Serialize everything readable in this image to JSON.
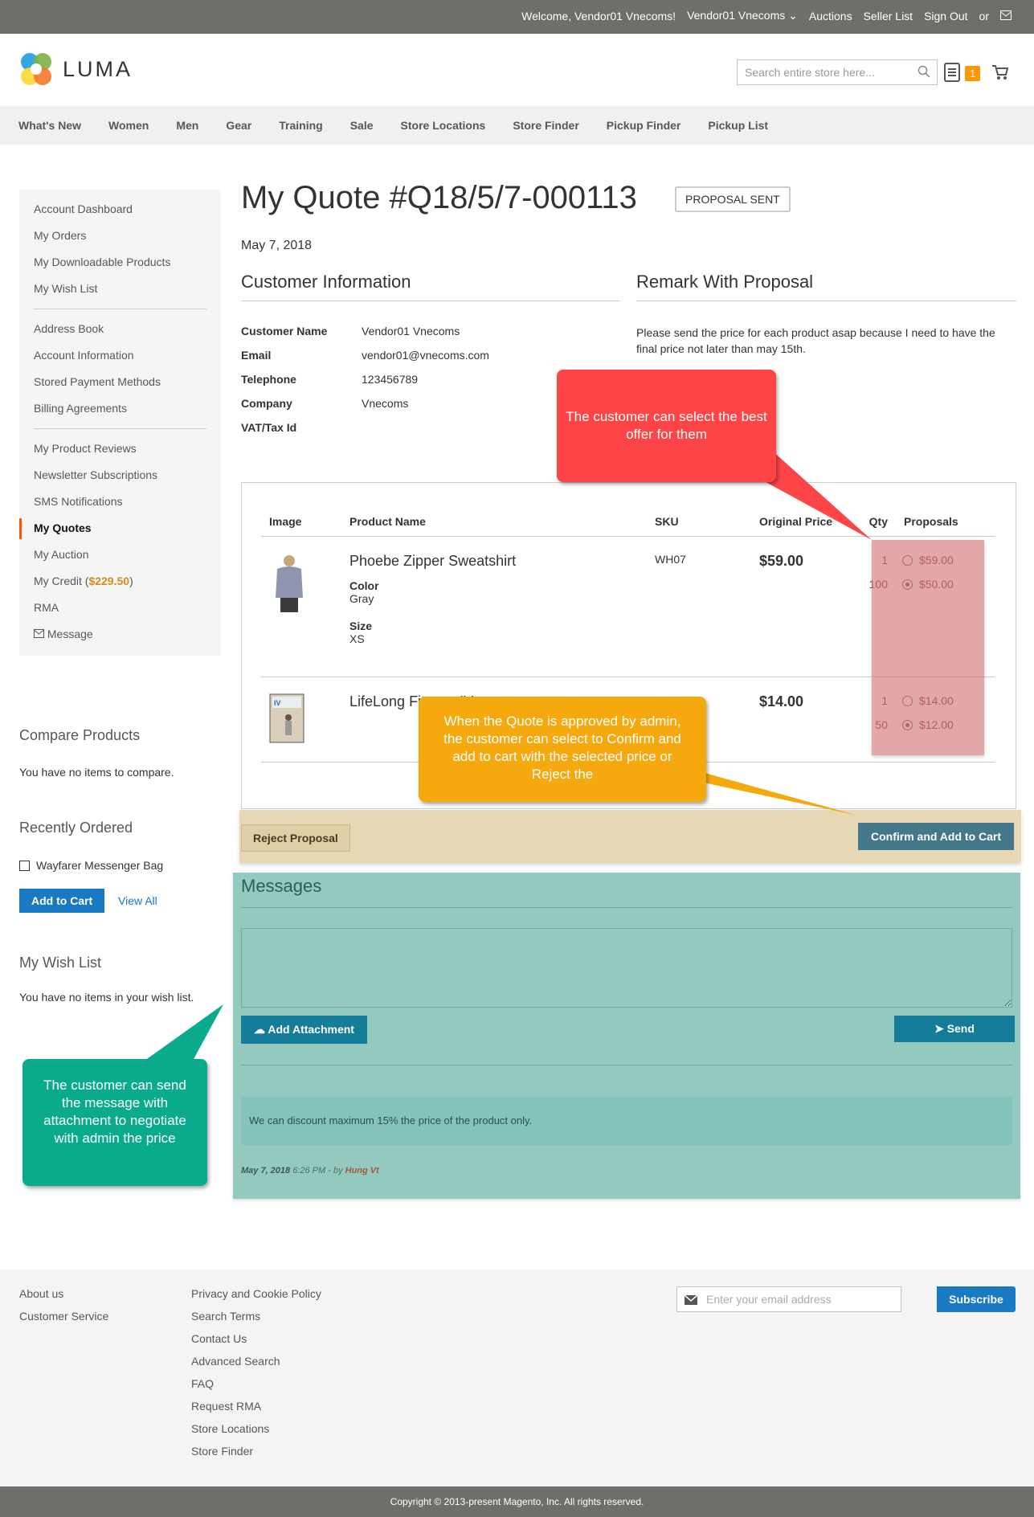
{
  "topbar": {
    "welcome": "Welcome, Vendor01 Vnecoms!",
    "account": "Vendor01 Vnecoms",
    "links": [
      "Auctions",
      "Seller List",
      "Sign Out"
    ],
    "or": "or"
  },
  "header": {
    "logo": "LUMA",
    "search_placeholder": "Search entire store here...",
    "cart_count": "1"
  },
  "nav": [
    "What's New",
    "Women",
    "Men",
    "Gear",
    "Training",
    "Sale",
    "Store Locations",
    "Store Finder",
    "Pickup Finder",
    "Pickup List"
  ],
  "sidebar": {
    "group1": [
      "Account Dashboard",
      "My Orders",
      "My Downloadable Products",
      "My Wish List"
    ],
    "group2": [
      "Address Book",
      "Account Information",
      "Stored Payment Methods",
      "Billing Agreements"
    ],
    "group3": [
      "My Product Reviews",
      "Newsletter Subscriptions",
      "SMS Notifications",
      "My Quotes",
      "My Auction"
    ],
    "credit_label": "My Credit (",
    "credit_value": "$229.50",
    "credit_close": ")",
    "rma": "RMA",
    "message": "Message",
    "active": "My Quotes"
  },
  "compare": {
    "title": "Compare Products",
    "text": "You have no items to compare."
  },
  "recent": {
    "title": "Recently Ordered",
    "item": "Wayfarer Messenger Bag",
    "add_to_cart": "Add to Cart",
    "view_all": "View All"
  },
  "wishlist": {
    "title": "My Wish List",
    "text": "You have no items in your wish list."
  },
  "quote": {
    "title": "My Quote #Q18/5/7-000113",
    "status": "PROPOSAL SENT",
    "date": "May 7, 2018",
    "customer_title": "Customer Information",
    "remark_title": "Remark With Proposal",
    "fields": [
      {
        "label": "Customer Name",
        "value": "Vendor01 Vnecoms"
      },
      {
        "label": "Email",
        "value": "vendor01@vnecoms.com"
      },
      {
        "label": "Telephone",
        "value": "123456789"
      },
      {
        "label": "Company",
        "value": "Vnecoms"
      },
      {
        "label": "VAT/Tax Id",
        "value": ""
      }
    ],
    "remark": "Please send the price for each product asap because I need to have the final price not later than may 15th."
  },
  "table": {
    "headers": [
      "Image",
      "Product Name",
      "SKU",
      "Original Price",
      "Qty",
      "Proposals"
    ],
    "rows": [
      {
        "name": "Phoebe Zipper Sweatshirt",
        "options": [
          {
            "label": "Color",
            "value": "Gray"
          },
          {
            "label": "Size",
            "value": "XS"
          }
        ],
        "sku": "WH07",
        "price": "$59.00",
        "proposals": [
          {
            "qty": "1",
            "price": "$59.00",
            "selected": false
          },
          {
            "qty": "100",
            "price": "$50.00",
            "selected": true
          }
        ]
      },
      {
        "name": "LifeLong Fitness IV",
        "options": [],
        "sku": "",
        "price": "$14.00",
        "proposals": [
          {
            "qty": "1",
            "price": "$14.00",
            "selected": false
          },
          {
            "qty": "50",
            "price": "$12.00",
            "selected": true
          }
        ]
      }
    ]
  },
  "actions": {
    "reject": "Reject Proposal",
    "confirm": "Confirm and Add to Cart"
  },
  "messages": {
    "title": "Messages",
    "add_attachment": "Add Attachment",
    "send": "Send",
    "items": [
      {
        "text": "We can discount maximum 15% the price of the product only.",
        "date": "May 7, 2018",
        "time": "6:26 PM - by",
        "author": "Hung Vt"
      }
    ]
  },
  "callouts": {
    "red": "The customer can select the best offer for them",
    "orange": "When the Quote is approved by admin, the customer can select to Confirm and add to cart with the selected price or Reject the",
    "green": "The customer can send the message with attachment to negotiate with admin the price"
  },
  "footer": {
    "col1": [
      "About us",
      "Customer Service"
    ],
    "col2": [
      "Privacy and Cookie Policy",
      "Search Terms",
      "Contact Us",
      "Advanced Search",
      "FAQ",
      "Request RMA",
      "Store Locations",
      "Store Finder"
    ],
    "newsletter_placeholder": "Enter your email address",
    "subscribe": "Subscribe",
    "copyright": "Copyright © 2013-present Magento, Inc. All rights reserved."
  },
  "colors": {
    "accent": "#1979c3",
    "active_marker": "#ff5501",
    "credit": "#d58c1a",
    "callout_red": "#fd4446",
    "callout_orange": "#f5a90f",
    "callout_green": "#0aab8c"
  }
}
